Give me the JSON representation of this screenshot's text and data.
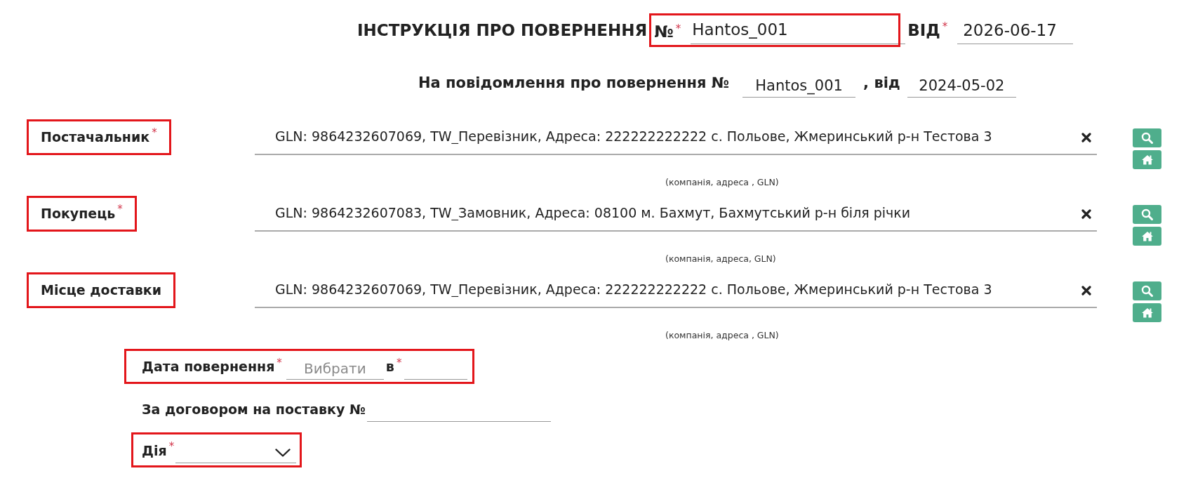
{
  "header": {
    "title": "ІНСТРУКЦІЯ ПРО ПОВЕРНЕННЯ",
    "number": {
      "label": "№",
      "mark": "*",
      "value": "Hantos_001",
      "highlighted": true
    },
    "date": {
      "label": "ВІД",
      "mark": "*",
      "value": "2026-06-17"
    }
  },
  "notice": {
    "label": "На повідомлення про повернення №",
    "number": "Hantos_001",
    "date_label": ", від",
    "date": "2024-05-02"
  },
  "parties": [
    {
      "label": "Постачальник",
      "mark": "*",
      "highlighted": true,
      "value": "GLN: 9864232607069, TW_Перевізник, Адреса: 222222222222 с. Польове, Жмеринський р-н Тестова 3",
      "hint": "(компанія, адреса , GLN)"
    },
    {
      "label": "Покупець",
      "mark": "*",
      "highlighted": true,
      "value": "GLN: 9864232607083, TW_Замовник, Адреса: 08100 м. Бахмут, Бахмутський р-н біля річки",
      "hint": "(компанія, адреса, GLN)"
    },
    {
      "label": "Місце доставки",
      "highlighted": true,
      "value": "GLN: 9864232607069, TW_Перевізник, Адреса: 222222222222 с. Польове, Жмеринський р-н Тестова 3",
      "hint": "(компанія, адреса , GLN)"
    }
  ],
  "return_date": {
    "label": "Дата повернення",
    "mark": "*",
    "placeholder": "Вибрати",
    "time_label": "в",
    "time_mark": "*",
    "highlighted": true
  },
  "contract": {
    "label": "За договором на поставку №"
  },
  "action": {
    "label": "Дія",
    "mark": "*",
    "highlighted": true
  }
}
